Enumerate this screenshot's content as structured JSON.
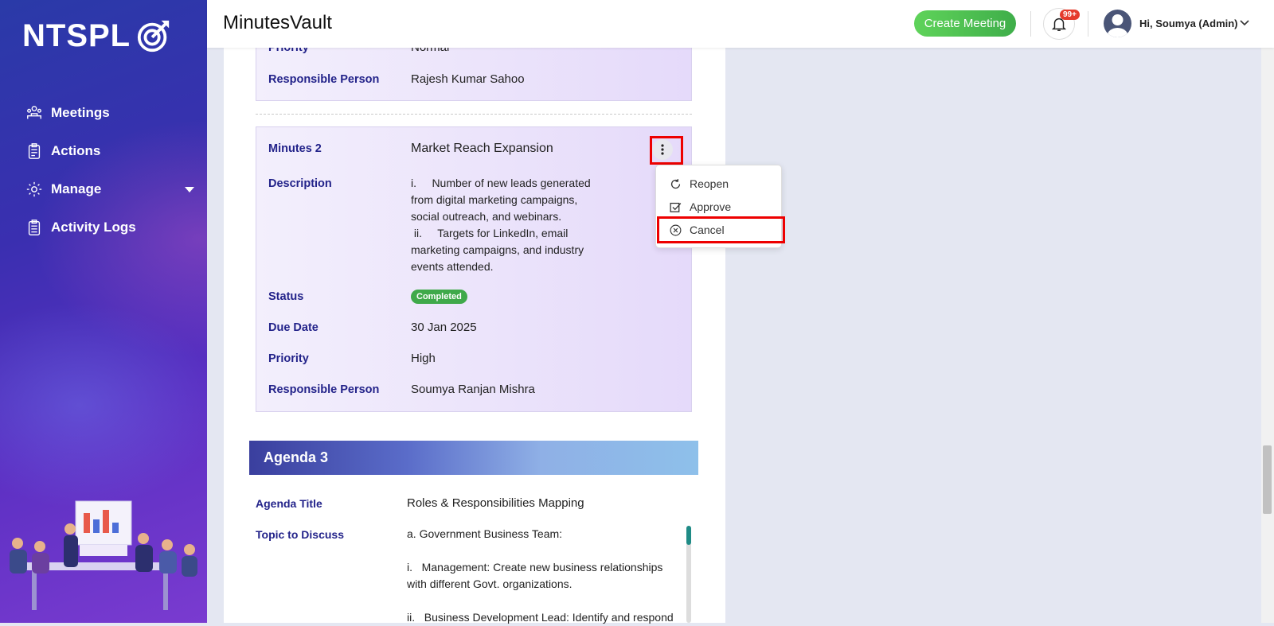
{
  "sidebar": {
    "logo_text": "NTSPL",
    "items": [
      {
        "label": "Meetings",
        "icon": "meetings-icon"
      },
      {
        "label": "Actions",
        "icon": "clipboard-icon"
      },
      {
        "label": "Manage",
        "icon": "gear-icon"
      },
      {
        "label": "Activity Logs",
        "icon": "logs-icon"
      }
    ]
  },
  "header": {
    "app_title": "MinutesVault",
    "create_button": "Create Meeting",
    "notification_badge": "99+",
    "user_greeting": "Hi, Soumya (Admin)"
  },
  "card1": {
    "priority_label": "Priority",
    "priority_value": "Normal",
    "person_label": "Responsible Person",
    "person_value": "Rajesh Kumar Sahoo"
  },
  "card2": {
    "minutes_label": "Minutes 2",
    "minutes_value": "Market Reach Expansion",
    "description_label": "Description",
    "description_lines": [
      "i.     Number of new leads generated",
      "from digital marketing campaigns,",
      "social outreach, and webinars.",
      " ii.     Targets for LinkedIn, email",
      "marketing campaigns, and industry",
      "events attended."
    ],
    "status_label": "Status",
    "status_value": "Completed",
    "due_label": "Due Date",
    "due_value": "30 Jan 2025",
    "priority_label": "Priority",
    "priority_value": "High",
    "person_label": "Responsible Person",
    "person_value": "Soumya Ranjan Mishra"
  },
  "menu": {
    "reopen": "Reopen",
    "approve": "Approve",
    "cancel": "Cancel"
  },
  "agenda": {
    "header": "Agenda 3",
    "title_label": "Agenda Title",
    "title_value": "Roles & Responsibilities Mapping",
    "topic_label": "Topic to Discuss",
    "topic_lines": [
      "a. Government Business Team:",
      "",
      "i.   Management: Create new business relationships",
      "with different Govt. organizations.",
      "",
      "ii.   Business Development Lead: Identify and respond"
    ]
  },
  "colors": {
    "accent_green": "#3fae4a",
    "label_navy": "#23238a",
    "highlight_red": "#e00"
  }
}
